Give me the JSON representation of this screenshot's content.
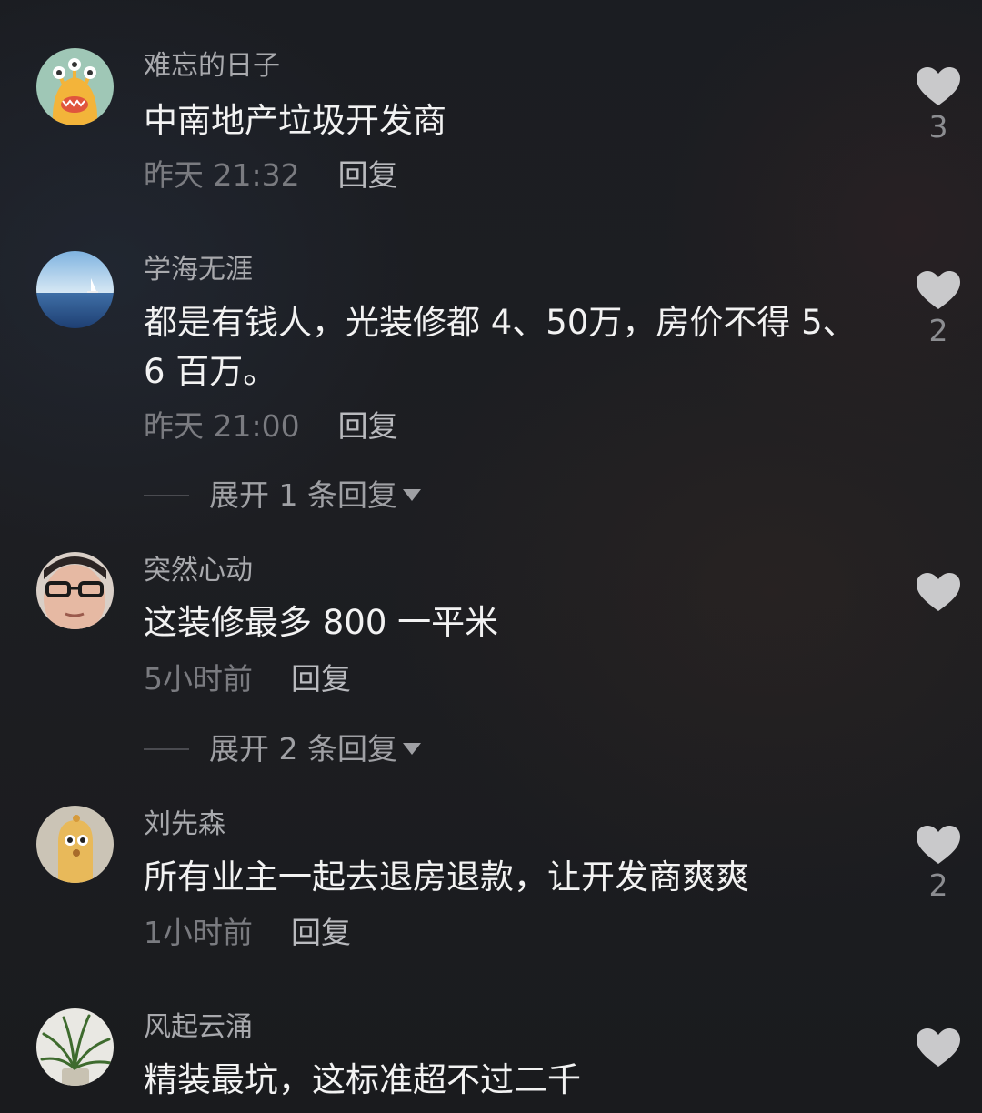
{
  "comments": [
    {
      "username": "难忘的日子",
      "text": "中南地产垃圾开发商",
      "time": "昨天 21:32",
      "reply_label": "回复",
      "like_count": "3",
      "avatar_icon": "yellow-monster-avatar"
    },
    {
      "username": "学海无涯",
      "text": "都是有钱人，光装修都 4、50万，房价不得 5、6 百万。",
      "time": "昨天 21:00",
      "reply_label": "回复",
      "like_count": "2",
      "expand_label": "展开 1 条回复",
      "avatar_icon": "sea-sailboat-avatar"
    },
    {
      "username": "突然心动",
      "text": "这装修最多 800 一平米",
      "time": "5小时前",
      "reply_label": "回复",
      "like_count": "",
      "expand_label": "展开 2 条回复",
      "avatar_icon": "man-glasses-avatar"
    },
    {
      "username": "刘先森",
      "text": "所有业主一起去退房退款，让开发商爽爽",
      "time": "1小时前",
      "reply_label": "回复",
      "like_count": "2",
      "avatar_icon": "cartoon-sausage-avatar"
    },
    {
      "username": "风起云涌",
      "text": "精装最坑，这标准超不过二千",
      "time": "",
      "reply_label": "",
      "like_count": "",
      "avatar_icon": "plant-avatar"
    }
  ],
  "colors": {
    "background": "#1c1d21",
    "username": "#a8a9ad",
    "text": "#f2f2f2",
    "time": "#7a7b80",
    "heart": "#c9c9cb"
  }
}
